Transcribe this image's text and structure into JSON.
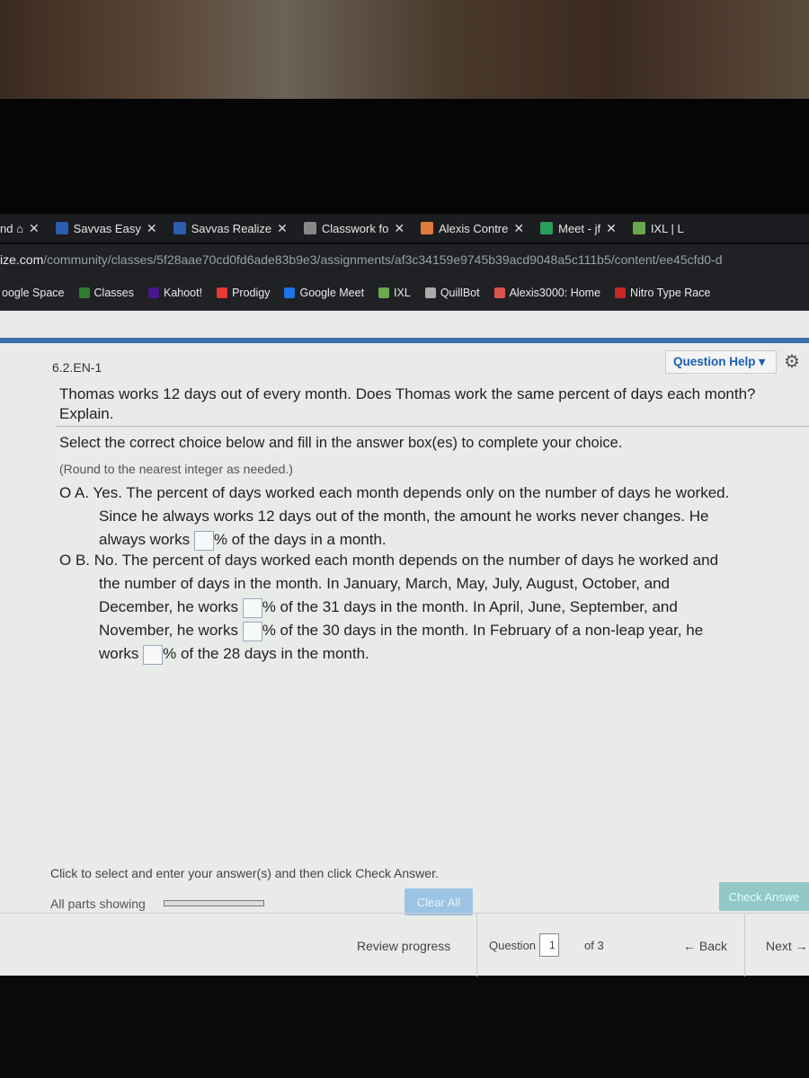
{
  "tabs": [
    {
      "label": "nd ⌂",
      "icon": "page-icon",
      "color": "#555"
    },
    {
      "label": "Savvas Easy",
      "icon": "savvas-icon",
      "color": "#2a5db0"
    },
    {
      "label": "Savvas Realize",
      "icon": "savvas-icon",
      "color": "#2a5db0"
    },
    {
      "label": "Classwork fo",
      "icon": "classroom-icon",
      "color": "#888"
    },
    {
      "label": "Alexis Contre",
      "icon": "slides-icon",
      "color": "#e07a3a"
    },
    {
      "label": "Meet - jf",
      "icon": "meet-icon",
      "color": "#2a9d5c"
    },
    {
      "label": "IXL | L",
      "icon": "ixl-icon",
      "color": "#6aa84f"
    }
  ],
  "url": {
    "domain": "ize.com",
    "path": "/community/classes/5f28aae70cd0fd6ade83b9e3/assignments/af3c34159e9745b39acd9048a5c111b5/content/ee45cfd0-d"
  },
  "bookmarks": [
    "oogle Space",
    "Classes",
    "Kahoot!",
    "Prodigy",
    "Google Meet",
    "IXL",
    "QuillBot",
    "Alexis3000: Home",
    "Nitro Type Race"
  ],
  "question": {
    "id": "6.2.EN-1",
    "help": "Question Help",
    "text": "Thomas works 12 days out of every month. Does Thomas work the same percent of days each month? Explain.",
    "instruction": "Select the correct choice below and fill in the answer box(es) to complete your choice.",
    "round": "(Round to the nearest integer as needed.)"
  },
  "optionA": {
    "label": "O A.",
    "l1": "Yes. The percent of days worked each month depends only on the number of days he worked.",
    "l2": "Since he always works 12 days out of the month, the amount he works never changes. He",
    "l3a": "always works",
    "l3b": "% of the days in a month."
  },
  "optionB": {
    "label": "O B.",
    "l1": "No. The percent of days worked each month depends on the number of days he worked and",
    "l2": "the number of days in the month. In January, March, May, July, August, October, and",
    "l3a": "December, he works",
    "l3b": "% of the 31 days in the month. In April, June, September, and",
    "l4a": "November, he works",
    "l4b": "% of the 30 days in the month. In February of a non-leap year, he",
    "l5a": "works",
    "l5b": "% of the 28 days in the month."
  },
  "footer": {
    "hint": "Click to select and enter your answer(s) and then click Check Answer.",
    "parts": "All parts showing",
    "clear": "Clear All",
    "check": "Check Answe",
    "review": "Review progress",
    "question_label": "Question",
    "question_num": "1",
    "of": "of 3",
    "back": "← Back",
    "next": "Next →"
  }
}
